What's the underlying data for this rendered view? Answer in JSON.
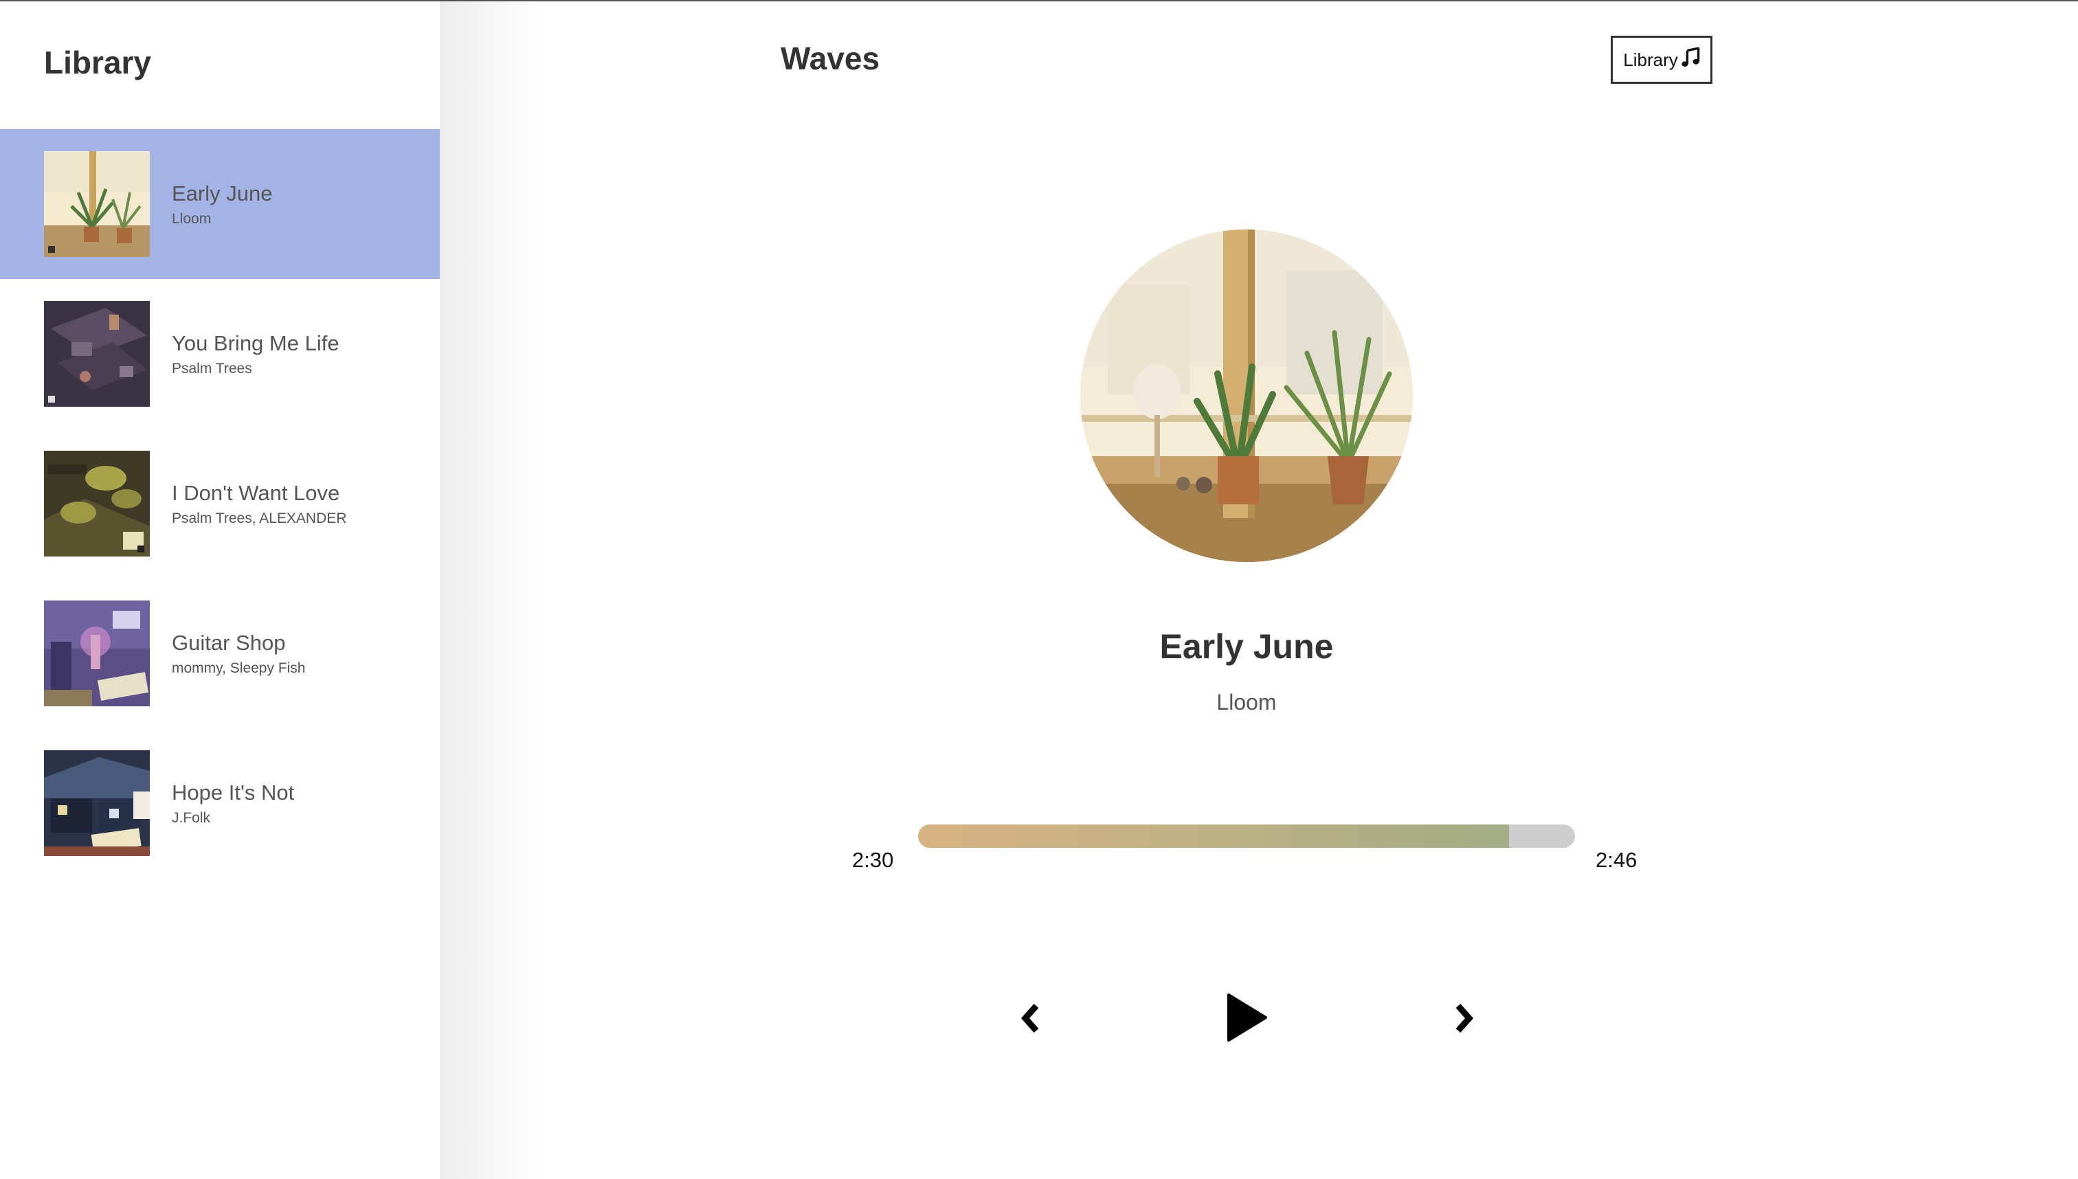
{
  "library": {
    "title": "Library",
    "songs": [
      {
        "title": "Early June",
        "artist": "Lloom",
        "active": true
      },
      {
        "title": "You Bring Me Life",
        "artist": "Psalm Trees",
        "active": false
      },
      {
        "title": "I Don't Want Love",
        "artist": "Psalm Trees, ALEXANDER",
        "active": false
      },
      {
        "title": "Guitar Shop",
        "artist": "mommy, Sleepy Fish",
        "active": false
      },
      {
        "title": "Hope It's Not",
        "artist": "J.Folk",
        "active": false
      }
    ]
  },
  "nav": {
    "title": "Waves",
    "library_button_label": "Library",
    "library_button_icon": "music-note-icon"
  },
  "now_playing": {
    "title": "Early June",
    "artist": "Lloom"
  },
  "player": {
    "current_time": "2:30",
    "duration": "2:46",
    "progress_fraction": 0.9,
    "gradient_colors": [
      "#d8b384",
      "#a3ad86"
    ],
    "controls": [
      "chevron-left-icon",
      "play-icon",
      "chevron-right-icon"
    ]
  },
  "colors": {
    "active_song_bg": "#a4b3e5",
    "track_bg": "#cdcdcd"
  }
}
